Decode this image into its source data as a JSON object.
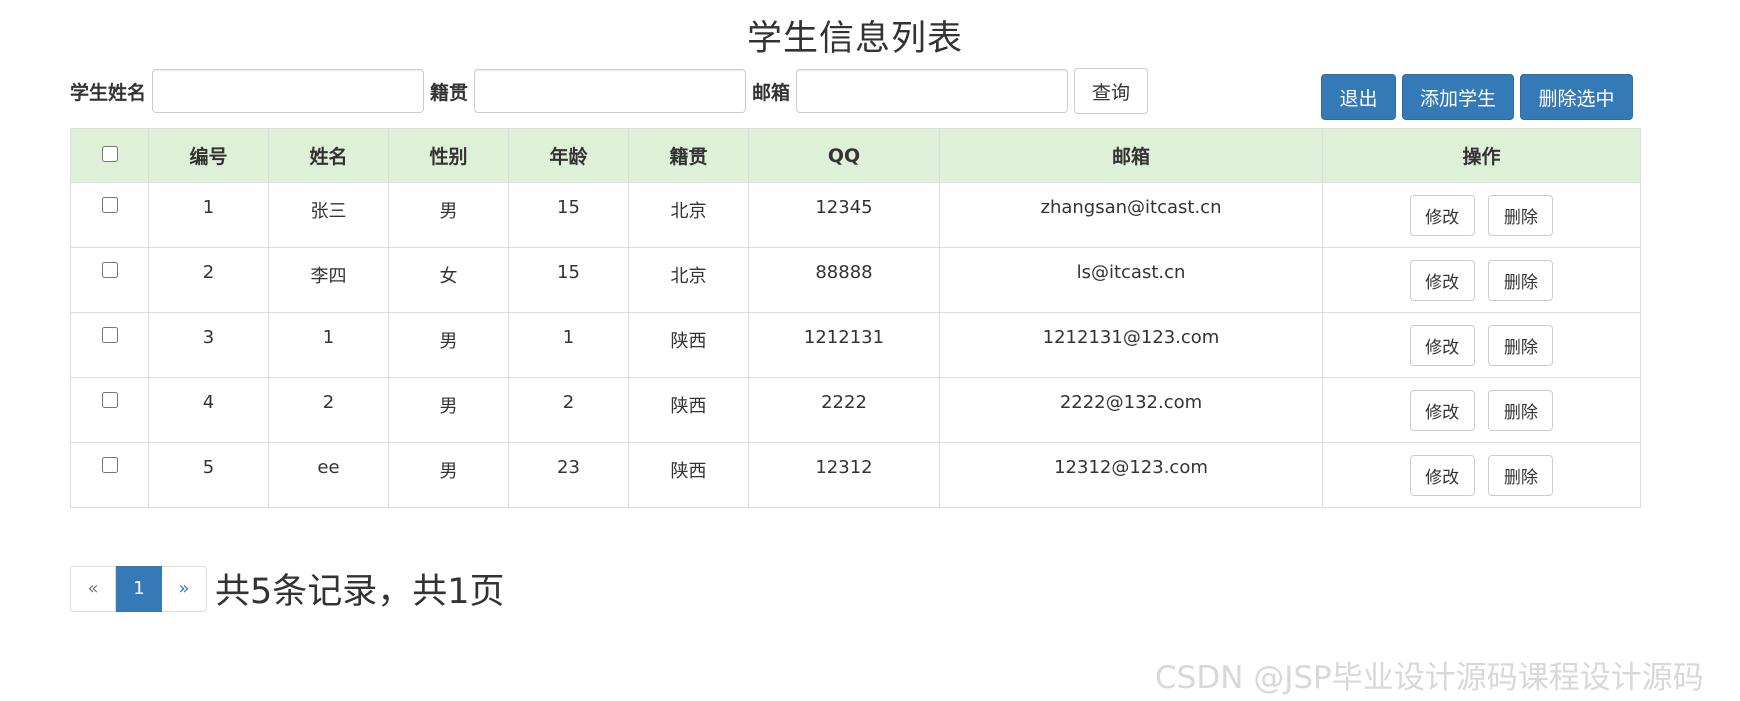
{
  "page_title": "学生信息列表",
  "search": {
    "name_label": "学生姓名",
    "name_value": "",
    "address_label": "籍贯",
    "address_value": "",
    "email_label": "邮箱",
    "email_value": "",
    "query_label": "查询"
  },
  "actions": {
    "exit_label": "退出",
    "add_label": "添加学生",
    "delete_selected_label": "删除选中"
  },
  "table": {
    "columns": [
      "编号",
      "姓名",
      "性别",
      "年龄",
      "籍贯",
      "QQ",
      "邮箱",
      "操作"
    ],
    "rows": [
      {
        "id": "1",
        "name": "张三",
        "gender": "男",
        "age": "15",
        "address": "北京",
        "qq": "12345",
        "email": "zhangsan@itcast.cn",
        "edit": "修改",
        "delete": "删除"
      },
      {
        "id": "2",
        "name": "李四",
        "gender": "女",
        "age": "15",
        "address": "北京",
        "qq": "88888",
        "email": "ls@itcast.cn",
        "edit": "修改",
        "delete": "删除"
      },
      {
        "id": "3",
        "name": "1",
        "gender": "男",
        "age": "1",
        "address": "陕西",
        "qq": "1212131",
        "email": "1212131@123.com",
        "edit": "修改",
        "delete": "删除"
      },
      {
        "id": "4",
        "name": "2",
        "gender": "男",
        "age": "2",
        "address": "陕西",
        "qq": "2222",
        "email": "2222@132.com",
        "edit": "修改",
        "delete": "删除"
      },
      {
        "id": "5",
        "name": "ee",
        "gender": "男",
        "age": "23",
        "address": "陕西",
        "qq": "12312",
        "email": "12312@123.com",
        "edit": "修改",
        "delete": "删除"
      }
    ]
  },
  "pagination": {
    "prev": "«",
    "current_page": "1",
    "next": "»",
    "summary": "共5条记录，共1页"
  },
  "watermark": "CSDN @JSP毕业设计源码课程设计源码",
  "colors": {
    "primary": "#337ab7",
    "header_bg": "#dff0d8",
    "border": "#dddddd"
  }
}
